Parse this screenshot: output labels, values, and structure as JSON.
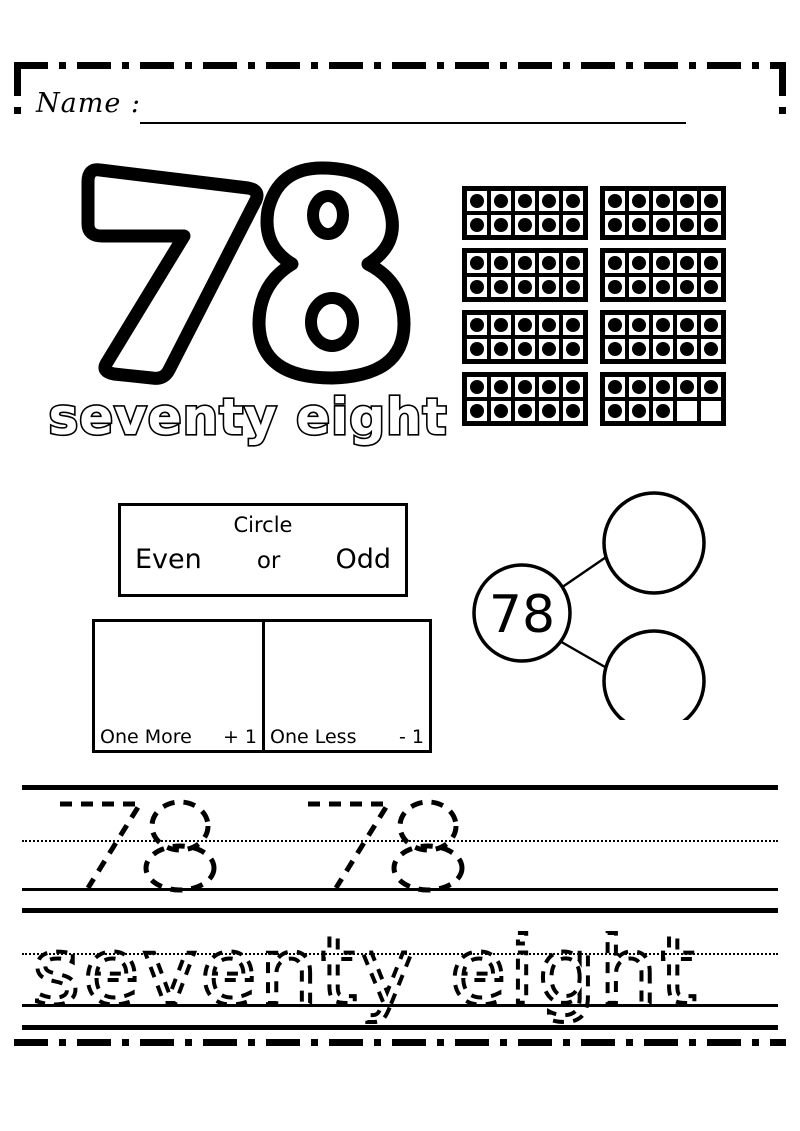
{
  "worksheet": {
    "number": "78",
    "number_word": "seventy eight",
    "name_label": "Name :"
  },
  "ten_frames": {
    "total_dots": 78,
    "frames": [
      10,
      10,
      10,
      10,
      10,
      10,
      10,
      8
    ],
    "columns": 5,
    "rows": 2
  },
  "even_odd": {
    "title": "Circle",
    "option_even": "Even",
    "option_or": "or",
    "option_odd": "Odd"
  },
  "more_less": {
    "one_more_label": "One More",
    "one_more_op": "+ 1",
    "one_more_answer": "",
    "one_less_label": "One Less",
    "one_less_op": "- 1",
    "one_less_answer": ""
  },
  "number_bond": {
    "whole": "78",
    "part_top": "",
    "part_bottom": ""
  },
  "tracing": {
    "number_row": "78  78",
    "word_row": "seventy eight"
  },
  "colors": {
    "ink": "#000000",
    "paper": "#ffffff"
  }
}
